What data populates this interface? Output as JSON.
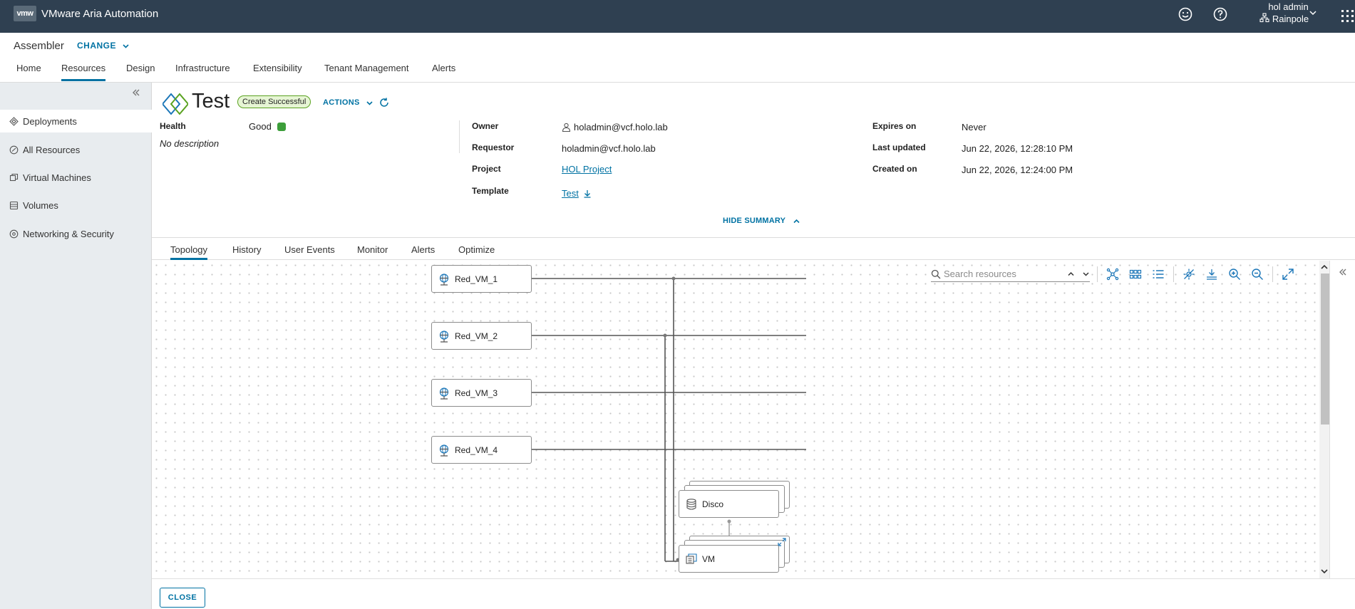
{
  "app": {
    "logo_text": "vmw",
    "title": "VMware Aria Automation",
    "user_name": "hol admin",
    "org_name": "Rainpole"
  },
  "subheader": {
    "service": "Assembler",
    "change_label": "CHANGE",
    "nav": [
      {
        "label": "Home"
      },
      {
        "label": "Resources"
      },
      {
        "label": "Design"
      },
      {
        "label": "Infrastructure"
      },
      {
        "label": "Extensibility"
      },
      {
        "label": "Tenant Management"
      },
      {
        "label": "Alerts"
      }
    ],
    "active_nav": "Resources"
  },
  "sidebar": {
    "items": [
      {
        "label": "Deployments",
        "icon": "deployments-icon",
        "active": true
      },
      {
        "label": "All Resources",
        "icon": "all-resources-icon"
      },
      {
        "label": "Virtual Machines",
        "icon": "vm-icon"
      },
      {
        "label": "Volumes",
        "icon": "volumes-icon"
      },
      {
        "label": "Networking & Security",
        "icon": "network-icon"
      }
    ]
  },
  "deployment": {
    "name": "Test",
    "status": "Create Successful",
    "actions_label": "ACTIONS",
    "health_label": "Health",
    "health_value": "Good",
    "health_color": "#3c9e3a",
    "description": "No description",
    "owner_label": "Owner",
    "owner_value": "holadmin@vcf.holo.lab",
    "requestor_label": "Requestor",
    "requestor_value": "holadmin@vcf.holo.lab",
    "project_label": "Project",
    "project_value": "HOL Project",
    "template_label": "Template",
    "template_value": "Test",
    "expires_label": "Expires on",
    "expires_value": "Never",
    "updated_label": "Last updated",
    "updated_value": "Jun 22, 2026, 12:28:10 PM",
    "created_label": "Created on",
    "created_value": "Jun 22, 2026, 12:24:00 PM",
    "hide_summary_label": "HIDE SUMMARY"
  },
  "tabs": [
    {
      "label": "Topology"
    },
    {
      "label": "History"
    },
    {
      "label": "User Events"
    },
    {
      "label": "Monitor"
    },
    {
      "label": "Alerts"
    },
    {
      "label": "Optimize"
    }
  ],
  "active_tab": "Topology",
  "topology": {
    "search_placeholder": "Search resources",
    "nodes": [
      {
        "label": "Red_VM_1",
        "type": "network"
      },
      {
        "label": "Red_VM_2",
        "type": "network"
      },
      {
        "label": "Red_VM_3",
        "type": "network"
      },
      {
        "label": "Red_VM_4",
        "type": "network"
      },
      {
        "label": "Disco",
        "type": "disk"
      },
      {
        "label": "VM",
        "type": "vm"
      }
    ]
  },
  "footer": {
    "close_label": "CLOSE"
  },
  "colors": {
    "header_bg": "#2f4051",
    "accent": "#0072a3",
    "sidebar_bg": "#e8ecef",
    "success": "#5aa220"
  }
}
